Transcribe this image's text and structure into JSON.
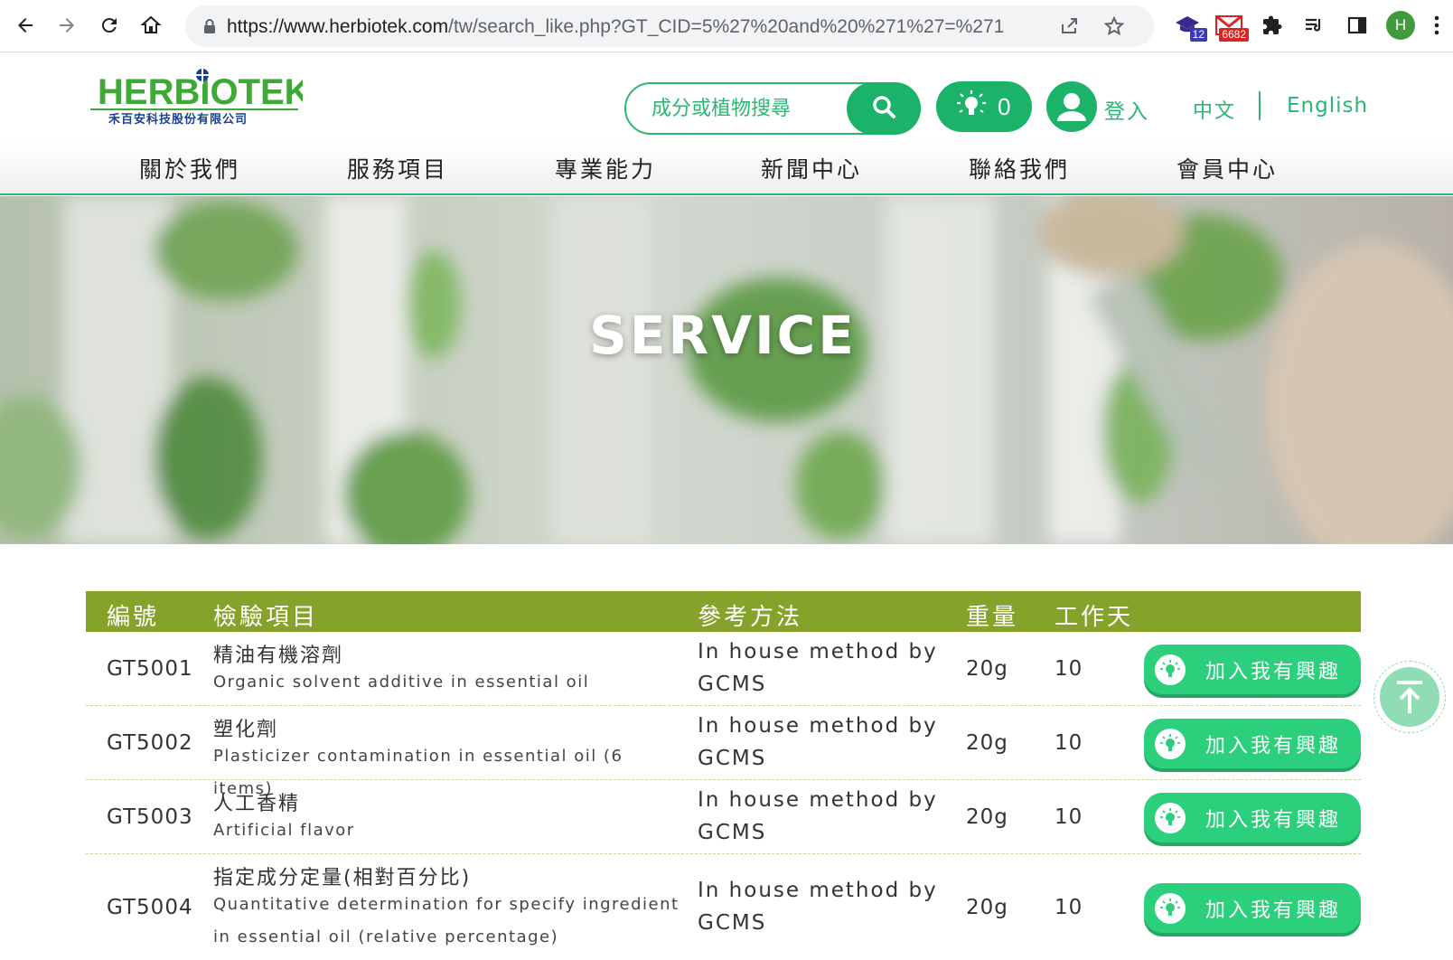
{
  "browser": {
    "url_host": "https://www.herbiotek.com",
    "url_path": "/tw/search_like.php?GT_CID=5%27%20and%20%271%27=%271",
    "ext_badge_1": "12",
    "ext_badge_2": "6682",
    "profile_initial": "H",
    "icons": [
      "back-arrow-icon",
      "forward-arrow-icon",
      "reload-icon",
      "home-icon",
      "lock-icon",
      "share-icon",
      "star-icon",
      "puzzle-icon",
      "reading-list-icon",
      "side-panel-icon"
    ]
  },
  "header": {
    "logo_text": "HERBIOTEK",
    "logo_subtext": "禾百安科技股份有限公司",
    "search_placeholder": "成分或植物搜尋",
    "interest_count": "0",
    "login_label": "登入",
    "lang_zh": "中文",
    "lang_en": "English"
  },
  "nav": {
    "items": [
      "關於我們",
      "服務項目",
      "專業能力",
      "新聞中心",
      "聯絡我們",
      "會員中心"
    ]
  },
  "hero": {
    "title": "SERVICE"
  },
  "table": {
    "headers": {
      "code": "編號",
      "item": "檢驗項目",
      "method": "參考方法",
      "weight": "重量",
      "days": "工作天"
    },
    "rows": [
      {
        "code": "GT5001",
        "name_zh": "精油有機溶劑",
        "name_en": "Organic solvent additive in essential oil",
        "method": "In house method by GCMS",
        "weight": "20g",
        "days": "10",
        "button": "加入我有興趣"
      },
      {
        "code": "GT5002",
        "name_zh": "塑化劑",
        "name_en": "Plasticizer contamination in essential oil (6 items)",
        "method": "In house method by GCMS",
        "weight": "20g",
        "days": "10",
        "button": "加入我有興趣"
      },
      {
        "code": "GT5003",
        "name_zh": "人工香精",
        "name_en": "Artificial flavor",
        "method": "In house method by GCMS",
        "weight": "20g",
        "days": "10",
        "button": "加入我有興趣"
      },
      {
        "code": "GT5004",
        "name_zh": "指定成分定量(相對百分比)",
        "name_en": "Quantitative determination for specify ingredient in essential oil (relative percentage)",
        "method": "In house method by GCMS",
        "weight": "20g",
        "days": "10",
        "button": "加入我有興趣"
      }
    ]
  },
  "colors": {
    "brand_green": "#1bb26a",
    "table_header": "#85a22a",
    "button_green": "#2ccf7c"
  }
}
